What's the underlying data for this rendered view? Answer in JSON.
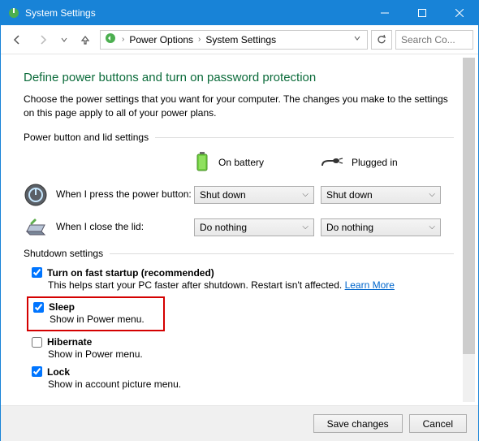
{
  "titlebar": {
    "title": "System Settings"
  },
  "breadcrumb": {
    "items": [
      "Power Options",
      "System Settings"
    ]
  },
  "search": {
    "placeholder": "Search Co..."
  },
  "heading": "Define power buttons and turn on password protection",
  "lead": "Choose the power settings that you want for your computer. The changes you make to the settings on this page apply to all of your power plans.",
  "section_power": {
    "title": "Power button and lid settings",
    "col_battery": "On battery",
    "col_plugged": "Plugged in",
    "row_power_btn": "When I press the power button:",
    "row_lid": "When I close the lid:",
    "val_power_battery": "Shut down",
    "val_power_plugged": "Shut down",
    "val_lid_battery": "Do nothing",
    "val_lid_plugged": "Do nothing"
  },
  "section_shutdown": {
    "title": "Shutdown settings",
    "fast_label": "Turn on fast startup (recommended)",
    "fast_desc": "This helps start your PC faster after shutdown. Restart isn't affected. ",
    "fast_link": "Learn More",
    "sleep_label": "Sleep",
    "sleep_desc": "Show in Power menu.",
    "hibernate_label": "Hibernate",
    "hibernate_desc": "Show in Power menu.",
    "lock_label": "Lock",
    "lock_desc": "Show in account picture menu."
  },
  "footer": {
    "save": "Save changes",
    "cancel": "Cancel"
  }
}
